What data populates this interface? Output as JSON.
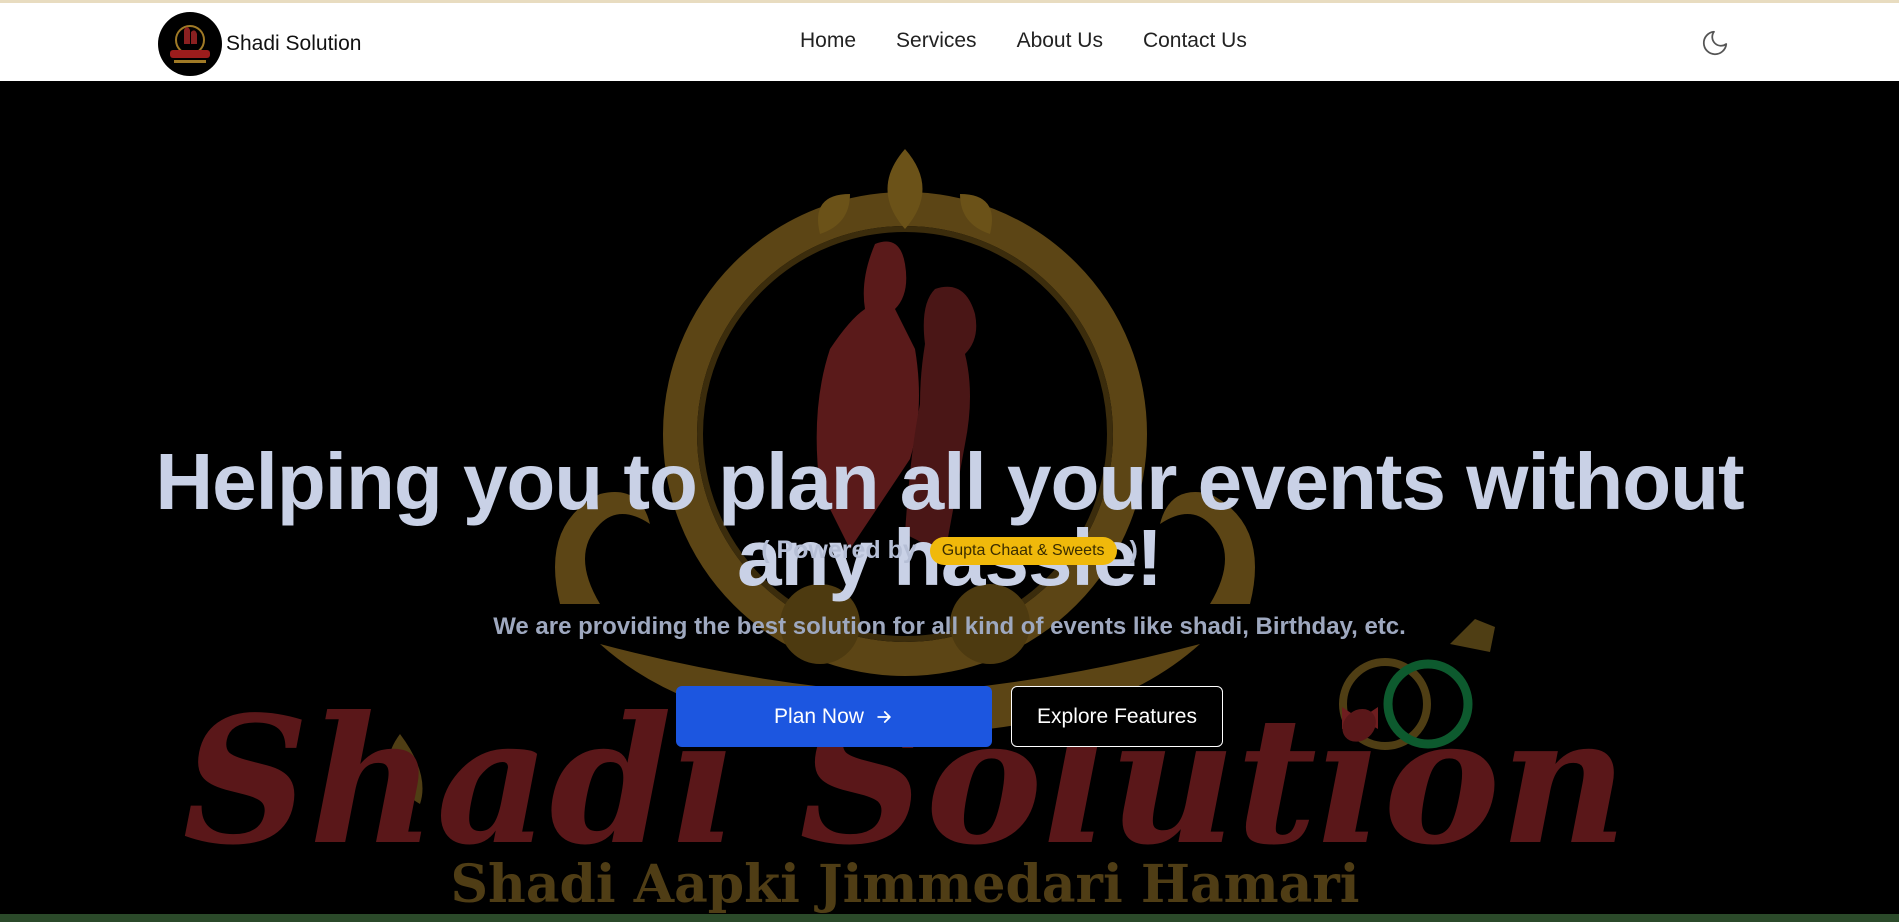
{
  "brand": {
    "name": "Shadi Solution",
    "logo_icon": "shadi-solution-logo-icon"
  },
  "nav": {
    "items": [
      {
        "label": "Home"
      },
      {
        "label": "Services"
      },
      {
        "label": "About Us"
      },
      {
        "label": "Contact Us"
      }
    ],
    "theme_toggle_icon": "moon-icon"
  },
  "hero": {
    "headline": "Helping you to plan all your events without any hassle!",
    "powered_prefix": "( Powered by",
    "powered_badge": "Gupta Chaat & Sweets",
    "powered_suffix": ")",
    "tagline": "We are providing the best solution for all kind of events like shadi, Birthday, etc.",
    "primary_button": "Plan Now",
    "primary_button_icon": "arrow-right-icon",
    "secondary_button": "Explore Features",
    "background_logo": {
      "wordmark": "Shadi Solution",
      "motto": "Shadi Aapki Jimmedari Hamari"
    }
  },
  "colors": {
    "primary": "#1c56e0",
    "badge": "#f0b90b",
    "gold": "#a07a26",
    "maroon": "#6e1d1f",
    "ring_green": "#0d5a2e"
  }
}
